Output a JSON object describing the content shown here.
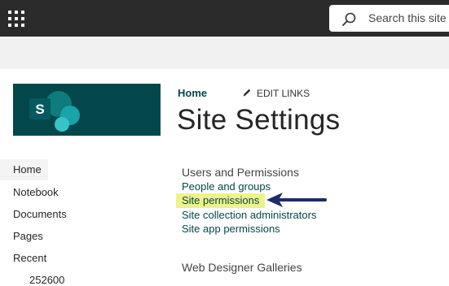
{
  "search": {
    "placeholder": "Search this site"
  },
  "logo": {
    "letter": "S"
  },
  "nav": {
    "items": [
      {
        "label": "Home"
      },
      {
        "label": "Notebook"
      },
      {
        "label": "Documents"
      },
      {
        "label": "Pages"
      },
      {
        "label": "Recent"
      },
      {
        "label": "252600"
      }
    ]
  },
  "header": {
    "breadcrumb_home": "Home",
    "edit_links": "EDIT LINKS",
    "title": "Site Settings"
  },
  "sections": [
    {
      "heading": "Users and Permissions",
      "links": [
        {
          "label": "People and groups"
        },
        {
          "label": "Site permissions"
        },
        {
          "label": "Site collection administrators"
        },
        {
          "label": "Site app permissions"
        }
      ]
    },
    {
      "heading": "Web Designer Galleries"
    }
  ],
  "colors": {
    "suitebar": "#2b2b2b",
    "brand": "#03474a",
    "highlight": "#eef28a",
    "arrow": "#1f2a6b"
  }
}
